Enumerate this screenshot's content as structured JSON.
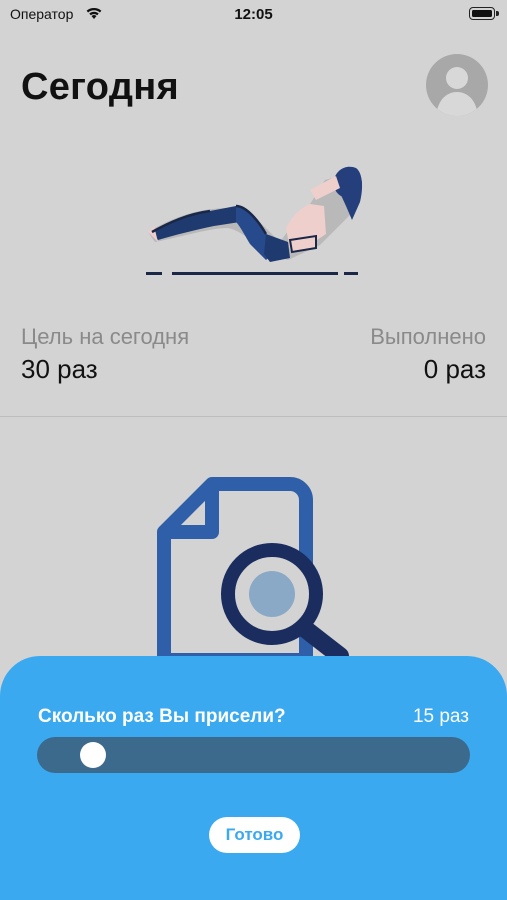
{
  "status_bar": {
    "carrier": "Оператор",
    "time": "12:05"
  },
  "header": {
    "title": "Сегодня"
  },
  "stats": {
    "goal_label": "Цель на сегодня",
    "goal_value": "30 раз",
    "done_label": "Выполнено",
    "done_value": "0 раз"
  },
  "sheet": {
    "question": "Сколько раз Вы присели?",
    "value": "15 раз",
    "slider_fraction": 0.05,
    "done_button": "Готово"
  },
  "colors": {
    "accent": "#3aa9f0",
    "track": "#3c6a8c",
    "background": "#d3d3d3"
  },
  "icons": [
    "wifi-icon",
    "battery-icon",
    "avatar-icon",
    "situp-illustration",
    "document-search-icon"
  ]
}
